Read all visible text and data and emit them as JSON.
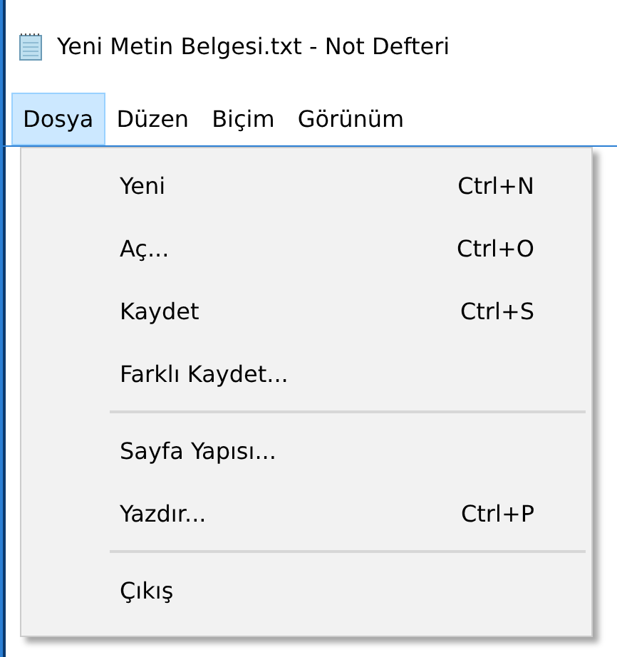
{
  "window": {
    "title": "Yeni Metin Belgesi.txt - Not Defteri"
  },
  "menu_bar": [
    {
      "label": "Dosya",
      "selected": true
    },
    {
      "label": "Düzen",
      "selected": false
    },
    {
      "label": "Biçim",
      "selected": false
    },
    {
      "label": "Görünüm",
      "selected": false
    }
  ],
  "menu": [
    {
      "kind": "item",
      "label": "Yeni",
      "shortcut": "Ctrl+N"
    },
    {
      "kind": "item",
      "label": "Aç...",
      "shortcut": "Ctrl+O"
    },
    {
      "kind": "item",
      "label": "Kaydet",
      "shortcut": "Ctrl+S"
    },
    {
      "kind": "item",
      "label": "Farklı Kaydet..."
    },
    {
      "kind": "separator"
    },
    {
      "kind": "item",
      "label": "Sayfa Yapısı..."
    },
    {
      "kind": "item",
      "label": "Yazdır...",
      "shortcut": "Ctrl+P"
    },
    {
      "kind": "separator"
    },
    {
      "kind": "item",
      "label": "Çıkış"
    }
  ]
}
